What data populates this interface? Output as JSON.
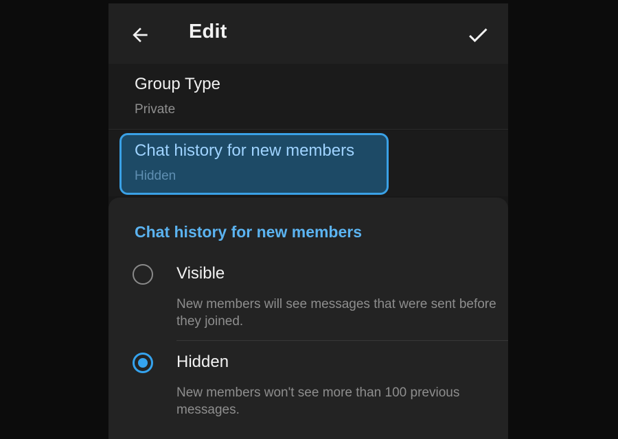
{
  "header": {
    "title": "Edit"
  },
  "settings": {
    "group_type": {
      "label": "Group Type",
      "value": "Private"
    },
    "chat_history": {
      "label": "Chat history for new members",
      "value": "Hidden"
    }
  },
  "sheet": {
    "title": "Chat history for new members",
    "options": [
      {
        "label": "Visible",
        "description": "New members will see messages that were sent before they joined.",
        "selected": false
      },
      {
        "label": "Hidden",
        "description": "New members won't see more than 100 previous messages.",
        "selected": true
      }
    ]
  },
  "colors": {
    "accent": "#35a3ee",
    "background": "#0c0c0c"
  },
  "icons": [
    "back-arrow-icon",
    "checkmark-icon",
    "radio-icon"
  ]
}
